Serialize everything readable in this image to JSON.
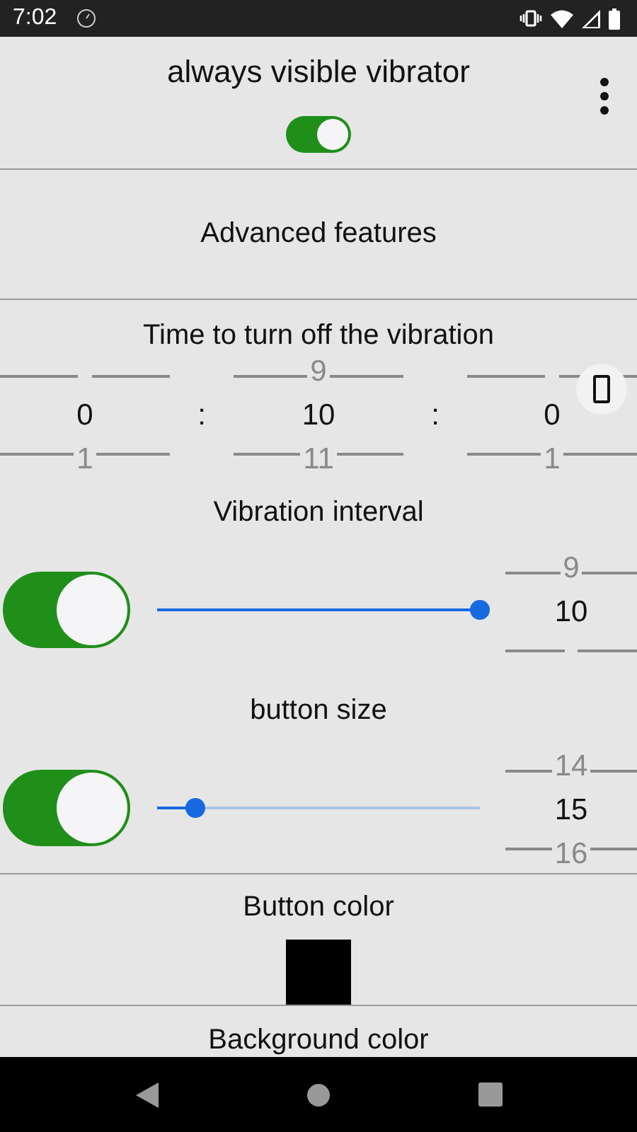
{
  "status_bar": {
    "time": "7:02"
  },
  "header": {
    "title": "always visible vibrator",
    "on": true
  },
  "advanced_button": "Advanced features",
  "timer": {
    "label": "Time to turn off the vibration",
    "separators": [
      ":",
      ":"
    ],
    "pickers": [
      {
        "value": "0",
        "next": "1"
      },
      {
        "previous": "9",
        "value": "10",
        "next": "11"
      },
      {
        "value": "0",
        "next": "1"
      }
    ]
  },
  "vibration_interval": {
    "label": "Vibration interval",
    "on": true,
    "level": 1,
    "picker": {
      "previous": "9",
      "value": "10"
    }
  },
  "button_size": {
    "label": "button size",
    "on": true,
    "level": 0.12,
    "picker": {
      "previous": "14",
      "value": "15",
      "next": "16"
    }
  },
  "button_color": {
    "label": "Button color",
    "color": "#000000"
  },
  "background_color": {
    "label": "Background color"
  }
}
